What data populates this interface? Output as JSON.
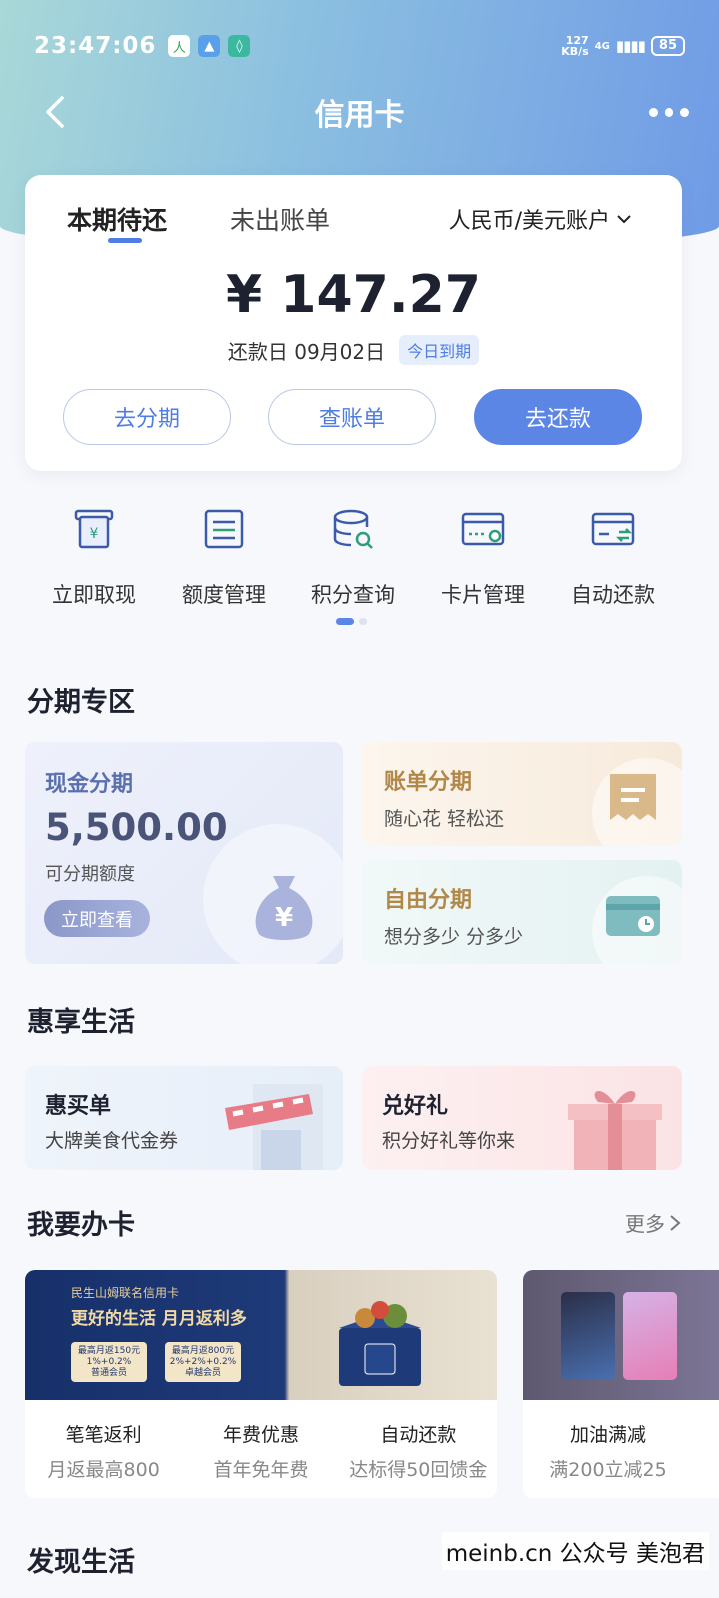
{
  "status_bar": {
    "time": "23:47:06",
    "net_speed_top": "127",
    "net_speed_bottom": "KB/s",
    "network": "4G",
    "battery": "85"
  },
  "nav": {
    "title": "信用卡"
  },
  "bill": {
    "tab_current": "本期待还",
    "tab_unbilled": "未出账单",
    "account": "人民币/美元账户",
    "amount": "¥ 147.27",
    "due_text": "还款日 09月02日",
    "due_badge": "今日到期",
    "btn_installment": "去分期",
    "btn_statement": "查账单",
    "btn_repay": "去还款"
  },
  "quick_actions": [
    {
      "label": "立即取现",
      "icon": "cash-withdraw-icon"
    },
    {
      "label": "额度管理",
      "icon": "limit-manage-icon"
    },
    {
      "label": "积分查询",
      "icon": "points-query-icon"
    },
    {
      "label": "卡片管理",
      "icon": "card-manage-icon"
    },
    {
      "label": "自动还款",
      "icon": "auto-repay-icon"
    }
  ],
  "installment_section": {
    "title": "分期专区",
    "cash": {
      "title": "现金分期",
      "amount": "5,500.00",
      "sub": "可分期额度",
      "button": "立即查看"
    },
    "bill": {
      "title": "账单分期",
      "sub": "随心花 轻松还"
    },
    "free": {
      "title": "自由分期",
      "sub": "想分多少 分多少"
    }
  },
  "life_section": {
    "title": "惠享生活",
    "items": [
      {
        "title": "惠买单",
        "sub": "大牌美食代金券"
      },
      {
        "title": "兑好礼",
        "sub": "积分好礼等你来"
      }
    ]
  },
  "card_section": {
    "title": "我要办卡",
    "more": "更多",
    "promo1": {
      "banner_small": "民生山姆联名信用卡",
      "banner_head": "更好的生活 月月返利多",
      "chip1": "最高月返150元",
      "chip1_sub": "1%+0.2%",
      "chip1_tag": "普通会员",
      "chip2": "最高月返800元",
      "chip2_sub": "2%+2%+0.2%",
      "chip2_tag": "卓越会员",
      "cols": [
        {
          "title": "笔笔返利",
          "sub": "月返最高800"
        },
        {
          "title": "年费优惠",
          "sub": "首年免年费"
        },
        {
          "title": "自动还款",
          "sub": "达标得50回馈金"
        }
      ]
    },
    "promo2": {
      "title": "加油满减",
      "sub": "满200立减25"
    }
  },
  "discover_title": "发现生活",
  "watermark": "meinb.cn 公众号 美泡君",
  "colors": {
    "accent": "#5c86e6",
    "gold": "#b28848"
  }
}
